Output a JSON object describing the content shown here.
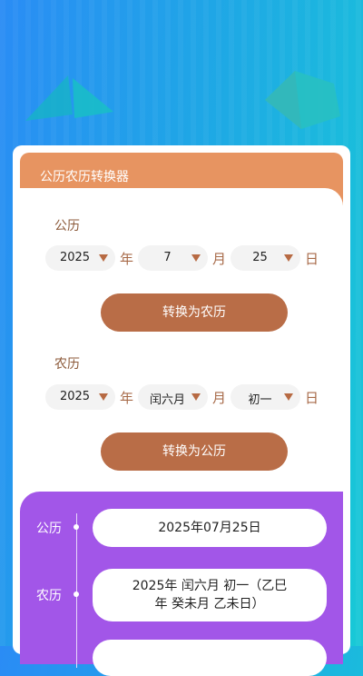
{
  "header": {
    "title": "公历农历转换器"
  },
  "solar": {
    "label": "公历",
    "year": "2025",
    "year_unit": "年",
    "month": "7",
    "month_unit": "月",
    "day": "25",
    "day_unit": "日",
    "convert_button": "转换为农历"
  },
  "lunar": {
    "label": "农历",
    "year": "2025",
    "year_unit": "年",
    "month": "闰六月",
    "month_unit": "月",
    "day": "初一",
    "day_unit": "日",
    "convert_button": "转换为公历"
  },
  "results": {
    "solar_label": "公历",
    "solar_value": "2025年07月25日",
    "lunar_label": "农历",
    "lunar_value_line1": "2025年  闰六月  初一（乙巳",
    "lunar_value_line2": "年  癸未月  乙未日）"
  },
  "colors": {
    "header": "#e79461",
    "button": "#b96d47",
    "result_panel": "#a256e8"
  }
}
